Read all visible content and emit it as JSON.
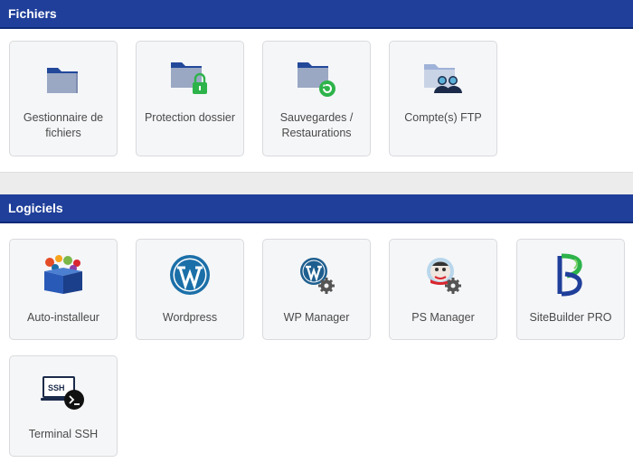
{
  "sections": {
    "fichiers": {
      "title": "Fichiers",
      "tiles": [
        {
          "label": "Gestionnaire de fichiers",
          "icon": "folder-icon"
        },
        {
          "label": "Protection dossier",
          "icon": "folder-lock-icon"
        },
        {
          "label": "Sauvegardes / Restaurations",
          "icon": "folder-backup-icon"
        },
        {
          "label": "Compte(s) FTP",
          "icon": "folder-users-icon"
        }
      ]
    },
    "logiciels": {
      "title": "Logiciels",
      "tiles": [
        {
          "label": "Auto-installeur",
          "icon": "app-box-icon"
        },
        {
          "label": "Wordpress",
          "icon": "wordpress-icon"
        },
        {
          "label": "WP Manager",
          "icon": "wordpress-gear-icon"
        },
        {
          "label": "PS Manager",
          "icon": "prestashop-gear-icon"
        },
        {
          "label": "SiteBuilder PRO",
          "icon": "sitebuilder-icon"
        },
        {
          "label": "Terminal SSH",
          "icon": "ssh-terminal-icon"
        }
      ]
    }
  },
  "colors": {
    "header_bg": "#1f3f9a",
    "folder_blue": "#22489a",
    "folder_light": "#9aa8c4",
    "wordpress_blue": "#1b6fa8",
    "green": "#2db34a"
  }
}
